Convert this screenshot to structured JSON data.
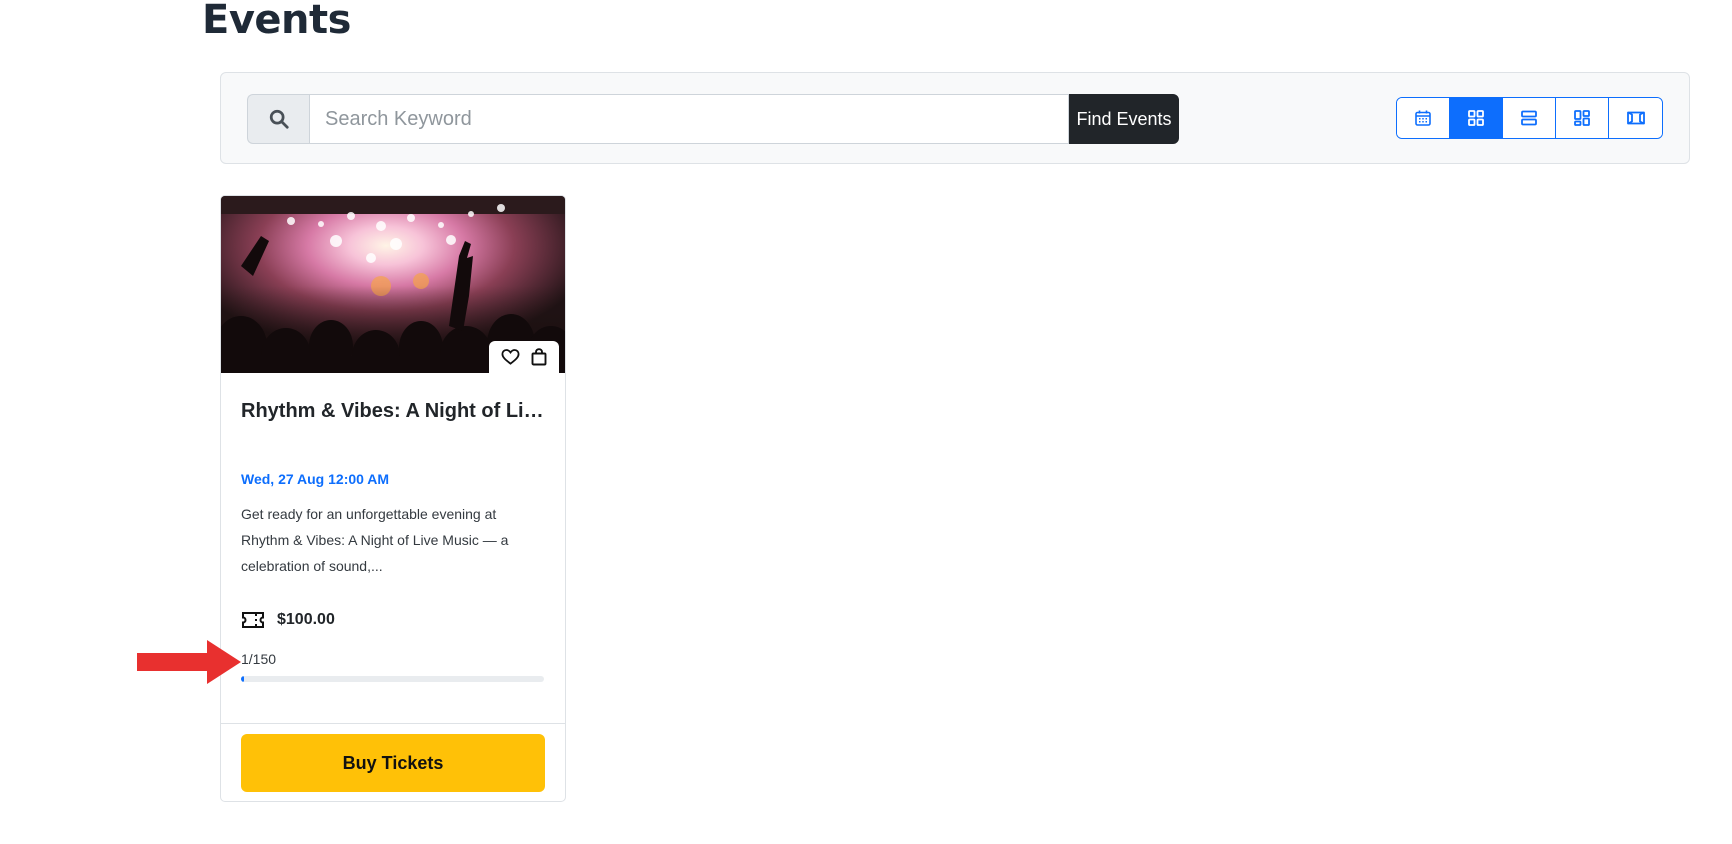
{
  "page": {
    "title": "Events"
  },
  "search": {
    "placeholder": "Search Keyword",
    "value": "",
    "button_label": "Find Events",
    "icon": "search-icon"
  },
  "view_toggle": {
    "options": [
      {
        "name": "calendar-view",
        "icon": "calendar-icon",
        "active": false
      },
      {
        "name": "grid-view",
        "icon": "grid-icon",
        "active": true
      },
      {
        "name": "list-view",
        "icon": "list-icon",
        "active": false
      },
      {
        "name": "masonry-view",
        "icon": "masonry-icon",
        "active": false
      },
      {
        "name": "slider-view",
        "icon": "slider-icon",
        "active": false
      }
    ]
  },
  "event_card": {
    "title": "Rhythm & Vibes: A Night of Live Music",
    "date": "Wed, 27 Aug 12:00 AM",
    "description": "Get ready for an unforgettable evening at Rhythm & Vibes: A Night of Live Music — a celebration of sound,...",
    "price": "$100.00",
    "tickets_sold": "1/150",
    "progress_fraction": 0.0067,
    "buy_label": "Buy Tickets",
    "actions": [
      "heart-icon",
      "shopping-bag-icon"
    ],
    "image": "concert-crowd-image"
  },
  "annotation": {
    "arrow": "red-arrow",
    "color": "#e8302f"
  },
  "colors": {
    "primary": "#0d6efd",
    "dark": "#212529",
    "warning": "#ffc107"
  }
}
